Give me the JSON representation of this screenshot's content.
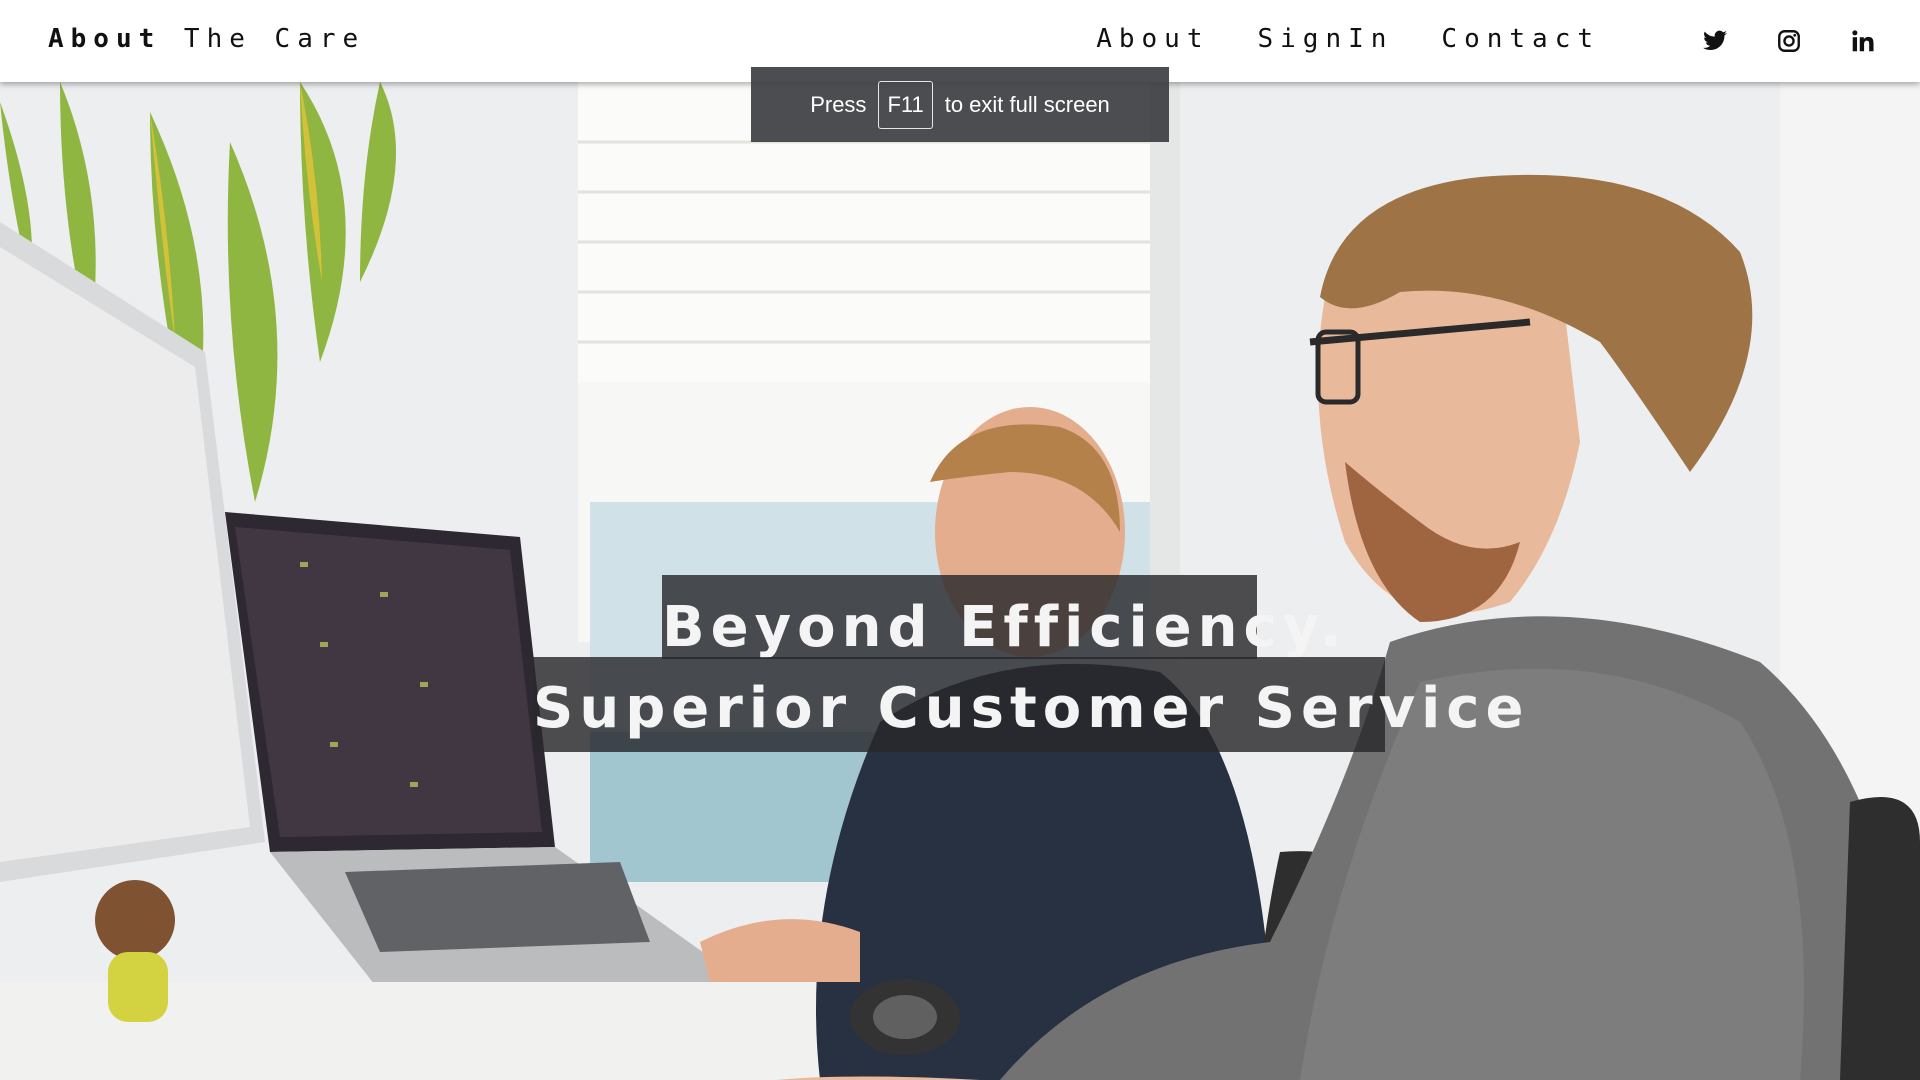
{
  "brand": {
    "bold": "About",
    "rest": " The Care"
  },
  "nav": {
    "items": [
      {
        "label": "About"
      },
      {
        "label": "SignIn"
      },
      {
        "label": "Contact"
      }
    ]
  },
  "social": {
    "icons": [
      "twitter-icon",
      "instagram-icon",
      "linkedin-icon"
    ]
  },
  "fullscreen_toast": {
    "press": "Press",
    "key": "F11",
    "message": "to exit full screen"
  },
  "hero": {
    "headline_line1": "Beyond Efficiency.",
    "headline_line2": "Superior Customer Service"
  },
  "colors": {
    "nav_bg": "#ffffff",
    "nav_text": "#111111",
    "headline_bg": "#28282c",
    "headline_text": "#f4f4f4",
    "toast_bg": "#3c3e42"
  }
}
